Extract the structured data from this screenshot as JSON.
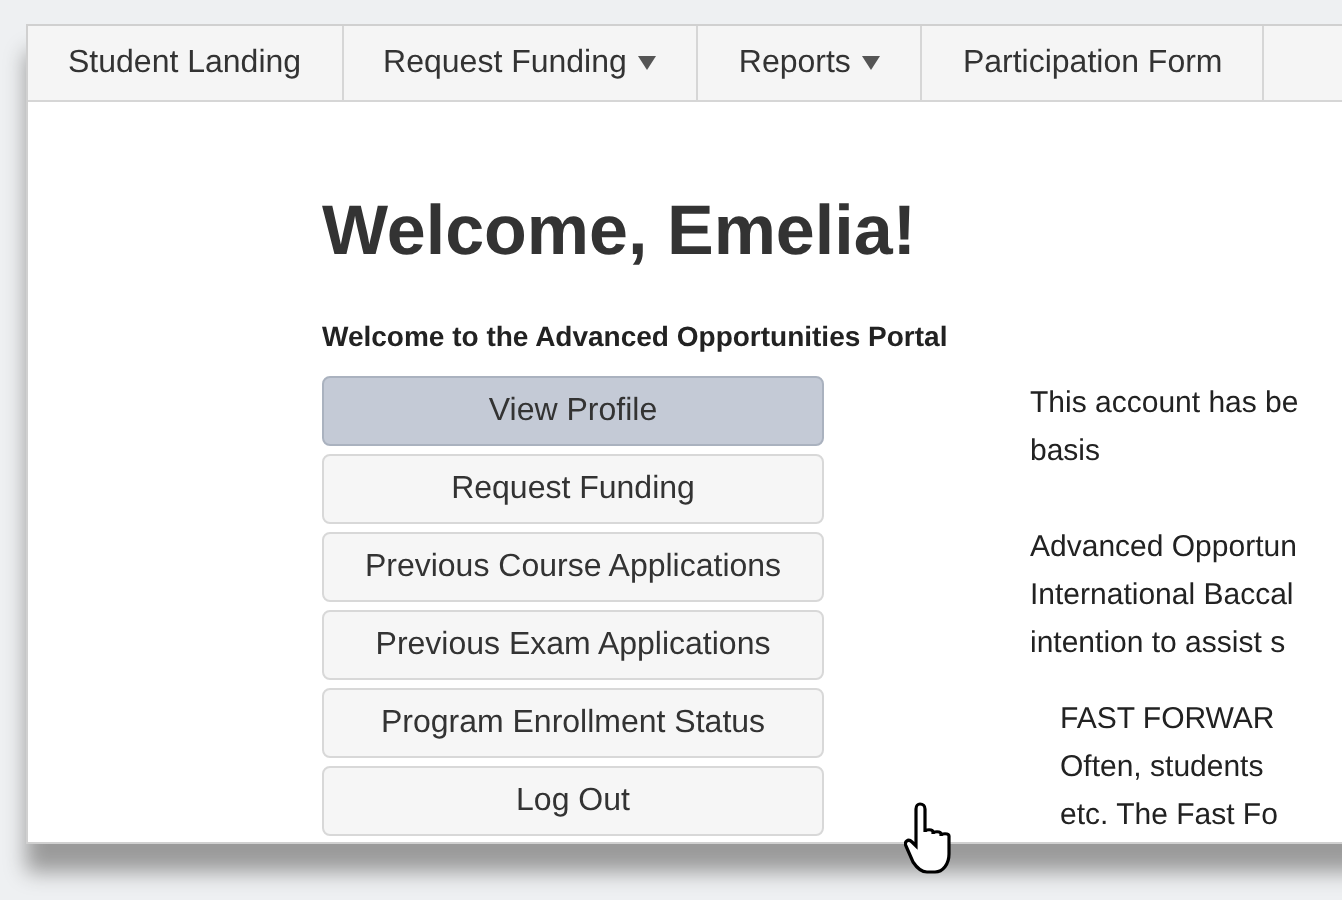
{
  "nav": [
    {
      "label": "Student Landing",
      "dropdown": false
    },
    {
      "label": "Request Funding",
      "dropdown": true
    },
    {
      "label": "Reports",
      "dropdown": true
    },
    {
      "label": "Participation Form",
      "dropdown": false
    }
  ],
  "heading": "Welcome, Emelia!",
  "subtitle": "Welcome to the Advanced Opportunities Portal",
  "menu": [
    {
      "label": "View Profile",
      "selected": true
    },
    {
      "label": "Request Funding",
      "selected": false
    },
    {
      "label": "Previous Course Applications",
      "selected": false
    },
    {
      "label": "Previous Exam Applications",
      "selected": false
    },
    {
      "label": "Program Enrollment Status",
      "selected": false
    },
    {
      "label": "Log Out",
      "selected": false
    }
  ],
  "paragraphs": [
    {
      "indented": false,
      "lines": [
        "This account has be",
        "basis"
      ]
    },
    {
      "indented": false,
      "lines": [
        "Advanced Opportun",
        "International Baccal",
        "intention to assist s"
      ]
    },
    {
      "indented": true,
      "lines": [
        "FAST FORWAR",
        "Often, students",
        "etc. The Fast Fo"
      ]
    }
  ]
}
